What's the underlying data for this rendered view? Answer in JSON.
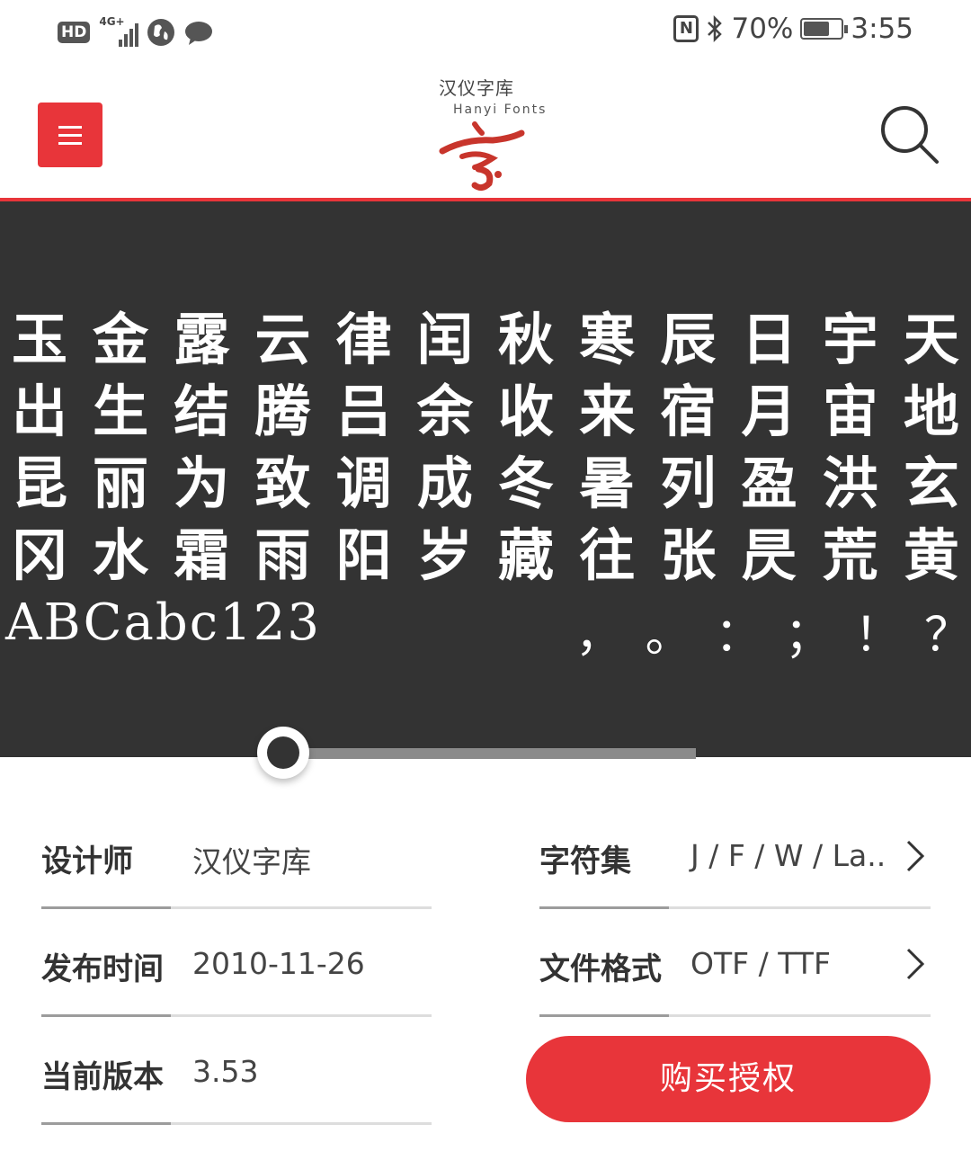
{
  "status_bar": {
    "hd": "HD",
    "network": "4G+",
    "battery_percent": "70%",
    "battery_level": 0.7,
    "time": "3:55",
    "icons": [
      "hd-icon",
      "signal-icon",
      "globe-icon",
      "chat-icon",
      "nfc-icon",
      "bluetooth-icon",
      "battery-icon"
    ]
  },
  "header": {
    "logo_cn": "汉仪字库",
    "logo_en": "Hanyi Fonts",
    "menu_icon": "menu-icon",
    "search_icon": "search-icon",
    "accent": "#e8353a"
  },
  "preview": {
    "background": "#333333",
    "rows": [
      [
        "玉",
        "金",
        "露",
        "云",
        "律",
        "闰",
        "秋",
        "寒",
        "辰",
        "日",
        "宇",
        "天"
      ],
      [
        "出",
        "生",
        "结",
        "腾",
        "吕",
        "余",
        "收",
        "来",
        "宿",
        "月",
        "宙",
        "地"
      ],
      [
        "昆",
        "丽",
        "为",
        "致",
        "调",
        "成",
        "冬",
        "暑",
        "列",
        "盈",
        "洪",
        "玄"
      ],
      [
        "冈",
        "水",
        "霜",
        "雨",
        "阳",
        "岁",
        "藏",
        "往",
        "张",
        "昃",
        "荒",
        "黄"
      ]
    ],
    "latin": "ABCabc123",
    "punctuation": [
      "，",
      "。",
      "：",
      "；",
      "！",
      "？"
    ],
    "slider_position": 0.03
  },
  "info": {
    "designer_label": "设计师",
    "designer_value": "汉仪字库",
    "charset_label": "字符集",
    "charset_value": "J / F / W / La..",
    "release_label": "发布时间",
    "release_value": "2010-11-26",
    "format_label": "文件格式",
    "format_value": "OTF / TTF",
    "version_label": "当前版本",
    "version_value": "3.53"
  },
  "buy_button": "购买授权"
}
